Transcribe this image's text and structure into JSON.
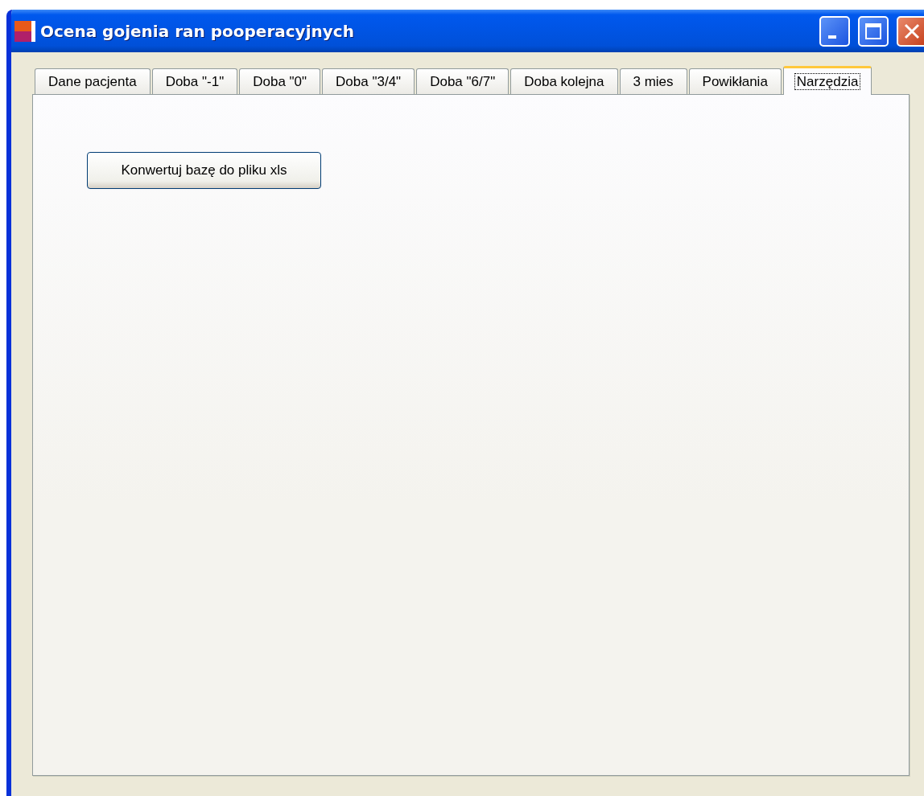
{
  "window": {
    "title": "Ocena gojenia ran pooperacyjnych"
  },
  "tabs": [
    {
      "label": "Dane pacjenta",
      "selected": false
    },
    {
      "label": "Doba \"-1\"",
      "selected": false
    },
    {
      "label": "Doba \"0\"",
      "selected": false
    },
    {
      "label": "Doba \"3/4\"",
      "selected": false
    },
    {
      "label": "Doba \"6/7\"",
      "selected": false
    },
    {
      "label": "Doba kolejna",
      "selected": false
    },
    {
      "label": "3 mies",
      "selected": false
    },
    {
      "label": "Powikłania",
      "selected": false
    },
    {
      "label": "Narzędzia",
      "selected": true
    }
  ],
  "buttons": [
    "Konwertuj bazę do pliku xls"
  ]
}
